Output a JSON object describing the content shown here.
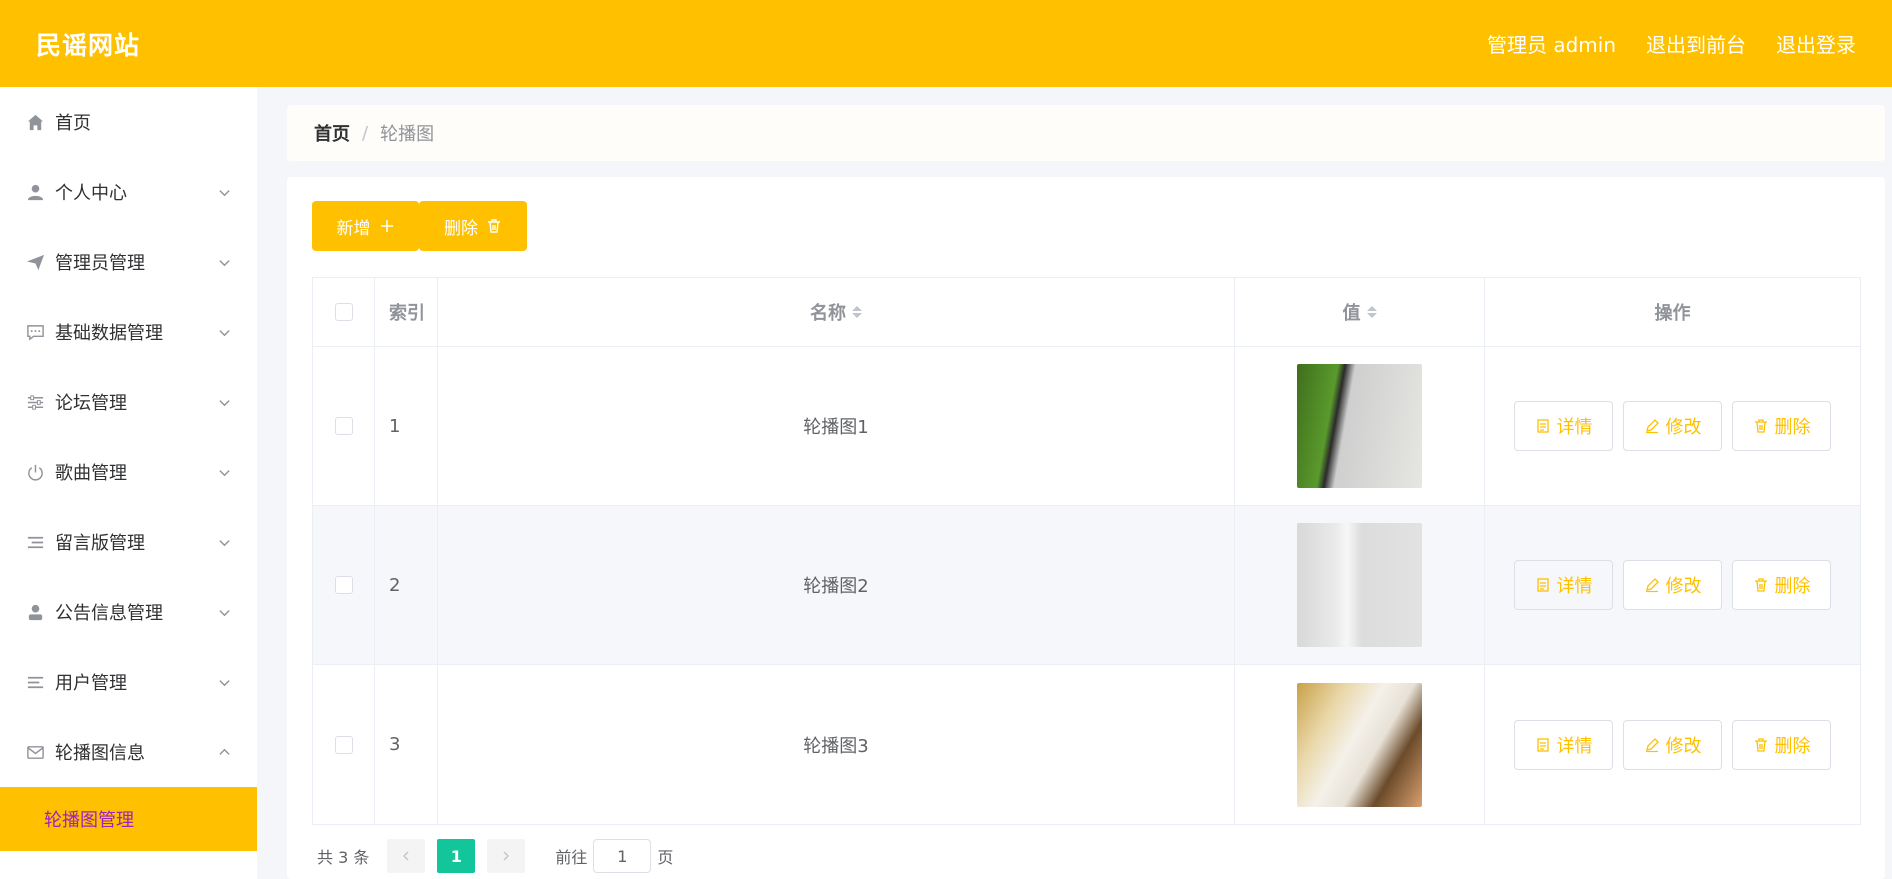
{
  "header": {
    "brand": "民谣网站",
    "user_label": "管理员 admin",
    "to_front": "退出到前台",
    "logout": "退出登录"
  },
  "sidebar": {
    "items": [
      {
        "label": "首页",
        "icon": "home-icon"
      },
      {
        "label": "个人中心",
        "icon": "user-icon"
      },
      {
        "label": "管理员管理",
        "icon": "send-icon"
      },
      {
        "label": "基础数据管理",
        "icon": "chat-icon"
      },
      {
        "label": "论坛管理",
        "icon": "sliders-icon"
      },
      {
        "label": "歌曲管理",
        "icon": "power-icon"
      },
      {
        "label": "留言版管理",
        "icon": "list-icon"
      },
      {
        "label": "公告信息管理",
        "icon": "user-solid-icon"
      },
      {
        "label": "用户管理",
        "icon": "menu-icon"
      },
      {
        "label": "轮播图信息",
        "icon": "mail-icon"
      }
    ],
    "sub_item": "轮播图管理"
  },
  "breadcrumb": {
    "home": "首页",
    "separator": "/",
    "current": "轮播图"
  },
  "toolbar": {
    "add_label": "新增",
    "delete_label": "删除"
  },
  "table": {
    "columns": {
      "index": "索引",
      "name": "名称",
      "value": "值",
      "ops": "操作"
    },
    "rows": [
      {
        "index": "1",
        "name": "轮播图1"
      },
      {
        "index": "2",
        "name": "轮播图2"
      },
      {
        "index": "3",
        "name": "轮播图3"
      }
    ],
    "ops": {
      "detail": "详情",
      "edit": "修改",
      "delete": "删除"
    }
  },
  "pager": {
    "total": "共 3 条",
    "current_page": "1",
    "goto_label": "前往",
    "goto_value": "1",
    "page_unit": "页"
  },
  "colors": {
    "accent": "#ffc000",
    "active_sub_text": "#a020c0",
    "pager_active": "#13c59a"
  }
}
